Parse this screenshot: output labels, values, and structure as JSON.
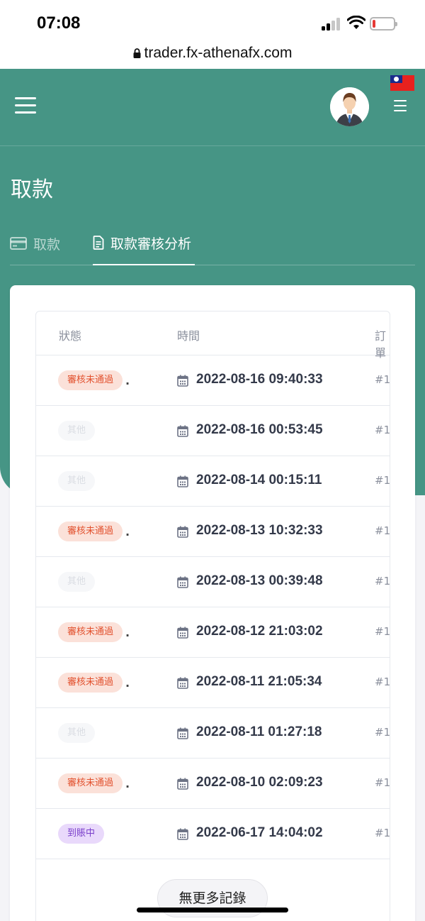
{
  "status_bar": {
    "time": "07:08"
  },
  "browser": {
    "url": "trader.fx-athenafx.com"
  },
  "header": {
    "title": "取款"
  },
  "tabs": [
    {
      "label": "取款",
      "active": false,
      "icon": "card-icon"
    },
    {
      "label": "取款審核分析",
      "active": true,
      "icon": "document-icon"
    }
  ],
  "table": {
    "columns": {
      "status": "狀態",
      "time": "時間",
      "order": "訂單"
    },
    "rows": [
      {
        "status": "審核未通過",
        "status_type": "reject",
        "time": "2022-08-16 09:40:33",
        "order": "#1"
      },
      {
        "status": "其他",
        "status_type": "other",
        "time": "2022-08-16 00:53:45",
        "order": "#1"
      },
      {
        "status": "其他",
        "status_type": "other",
        "time": "2022-08-14 00:15:11",
        "order": "#1"
      },
      {
        "status": "審核未通過",
        "status_type": "reject",
        "time": "2022-08-13 10:32:33",
        "order": "#1"
      },
      {
        "status": "其他",
        "status_type": "other",
        "time": "2022-08-13 00:39:48",
        "order": "#1"
      },
      {
        "status": "審核未通過",
        "status_type": "reject",
        "time": "2022-08-12 21:03:02",
        "order": "#1"
      },
      {
        "status": "審核未通過",
        "status_type": "reject",
        "time": "2022-08-11 21:05:34",
        "order": "#1"
      },
      {
        "status": "其他",
        "status_type": "other",
        "time": "2022-08-11 01:27:18",
        "order": "#1"
      },
      {
        "status": "審核未通過",
        "status_type": "reject",
        "time": "2022-08-10 02:09:23",
        "order": "#1"
      },
      {
        "status": "到賬中",
        "status_type": "transit",
        "time": "2022-06-17 14:04:02",
        "order": "#1"
      }
    ]
  },
  "footer": {
    "no_more_label": "無更多記錄"
  },
  "colors": {
    "brand": "#469585",
    "reject": "#e2512e",
    "transit": "#7a3fcb"
  }
}
